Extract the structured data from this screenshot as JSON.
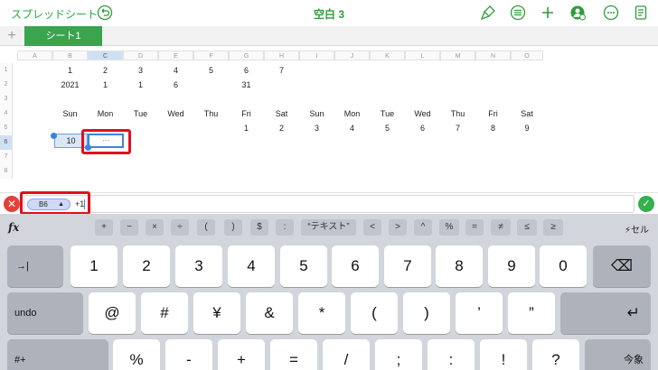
{
  "toolbar": {
    "back_label": "スプレッドシート",
    "title": "空白 3",
    "icons": [
      "undo-icon",
      "brush-icon",
      "list-icon",
      "add-icon",
      "collaborate-icon",
      "more-icon",
      "document-icon"
    ],
    "accent_color": "#2e9c3c"
  },
  "tabs": {
    "add_label": "+",
    "sheets": [
      "シート1"
    ]
  },
  "grid": {
    "columns": [
      "A",
      "B",
      "C",
      "D",
      "E",
      "F",
      "G",
      "H",
      "I",
      "J",
      "K",
      "L",
      "M",
      "N",
      "O"
    ],
    "rows": [
      "1",
      "2",
      "3",
      "4",
      "5",
      "6",
      "7",
      "8"
    ],
    "selected_column": "C",
    "selected_row": "6",
    "row1": [
      "1",
      "2",
      "3",
      "4",
      "5",
      "6",
      "7"
    ],
    "row2": [
      "2021",
      "1",
      "1",
      "6",
      "",
      "31",
      ""
    ],
    "row4": [
      "Sun",
      "Mon",
      "Tue",
      "Wed",
      "Thu",
      "Fri",
      "Sat",
      "Sun",
      "Mon",
      "Tue",
      "Wed",
      "Thu",
      "Fri",
      "Sat"
    ],
    "row5": [
      "",
      "",
      "",
      "",
      "",
      "1",
      "2",
      "3",
      "4",
      "5",
      "6",
      "7",
      "8",
      "9"
    ],
    "b6_value": "10",
    "c6_value": "···"
  },
  "formula_bar": {
    "cell_ref": "B6",
    "ref_dropdown": "▲",
    "expression": "+1"
  },
  "keyboard": {
    "fx_label": "fx",
    "cell_toggle": "⚡セル",
    "operators": [
      "+",
      "−",
      "×",
      "÷",
      "(",
      ")",
      "$",
      ":",
      "“テキスト”",
      "<",
      ">",
      "^",
      "%",
      "=",
      "≠",
      "≤",
      "≥"
    ],
    "digits": [
      "1",
      "2",
      "3",
      "4",
      "5",
      "6",
      "7",
      "8",
      "9",
      "0"
    ],
    "tab_key": "→|",
    "delete_key": "⌫",
    "undo_label": "undo",
    "row3_keys": [
      "@",
      "#",
      "¥",
      "&",
      "*",
      "(",
      ")",
      "’",
      "”"
    ],
    "return_key": "↵",
    "row4_left": "#+",
    "row4_keys": [
      "%",
      "-",
      "+",
      "=",
      "/",
      ";",
      ":",
      "!",
      "?"
    ],
    "row4_right": "今象"
  }
}
